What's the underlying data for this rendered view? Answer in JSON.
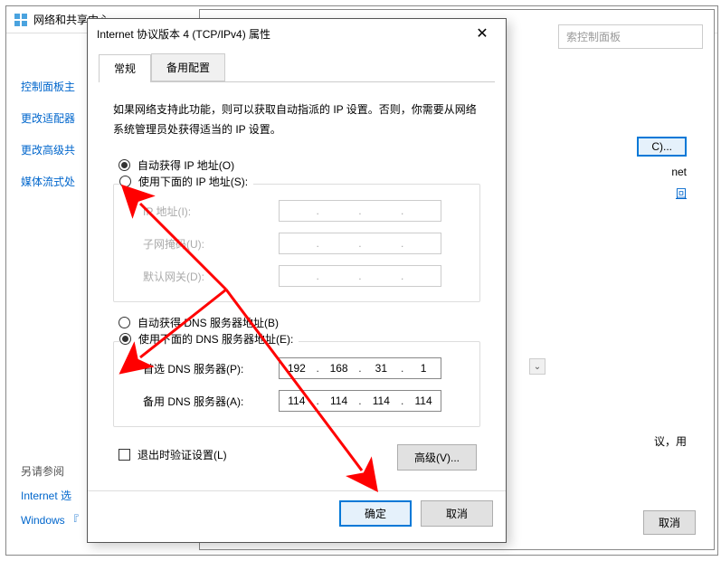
{
  "bg": {
    "title": "网络和共享中心",
    "sidebar": {
      "home": "控制面板主",
      "adapter": "更改适配器",
      "advanced": "更改高级共",
      "media": "媒体流式处"
    },
    "bottom": {
      "label": "另请参阅",
      "internet": "Internet 选",
      "windows": "Windows 『"
    },
    "search_placeholder": "索控制面板",
    "right": {
      "btn_c": "C)...",
      "net_label": "net",
      "link_tail": "回",
      "text_tail": "议，用",
      "cancel": "取消"
    }
  },
  "dlg": {
    "title": "Internet 协议版本 4 (TCP/IPv4) 属性",
    "tabs": {
      "general": "常规",
      "alt": "备用配置"
    },
    "help": "如果网络支持此功能，则可以获取自动指派的 IP 设置。否则，你需要从网络系统管理员处获得适当的 IP 设置。",
    "ip": {
      "auto": "自动获得 IP 地址(O)",
      "manual": "使用下面的 IP 地址(S):",
      "addr": "IP 地址(I):",
      "mask": "子网掩码(U):",
      "gateway": "默认网关(D):"
    },
    "dns": {
      "auto": "自动获得 DNS 服务器地址(B)",
      "manual": "使用下面的 DNS 服务器地址(E):",
      "primary": "首选 DNS 服务器(P):",
      "alt": "备用 DNS 服务器(A):",
      "primary_val": [
        "192",
        "168",
        "31",
        "1"
      ],
      "alt_val": [
        "114",
        "114",
        "114",
        "114"
      ]
    },
    "validate": "退出时验证设置(L)",
    "advanced": "高级(V)...",
    "ok": "确定",
    "cancel": "取消"
  }
}
